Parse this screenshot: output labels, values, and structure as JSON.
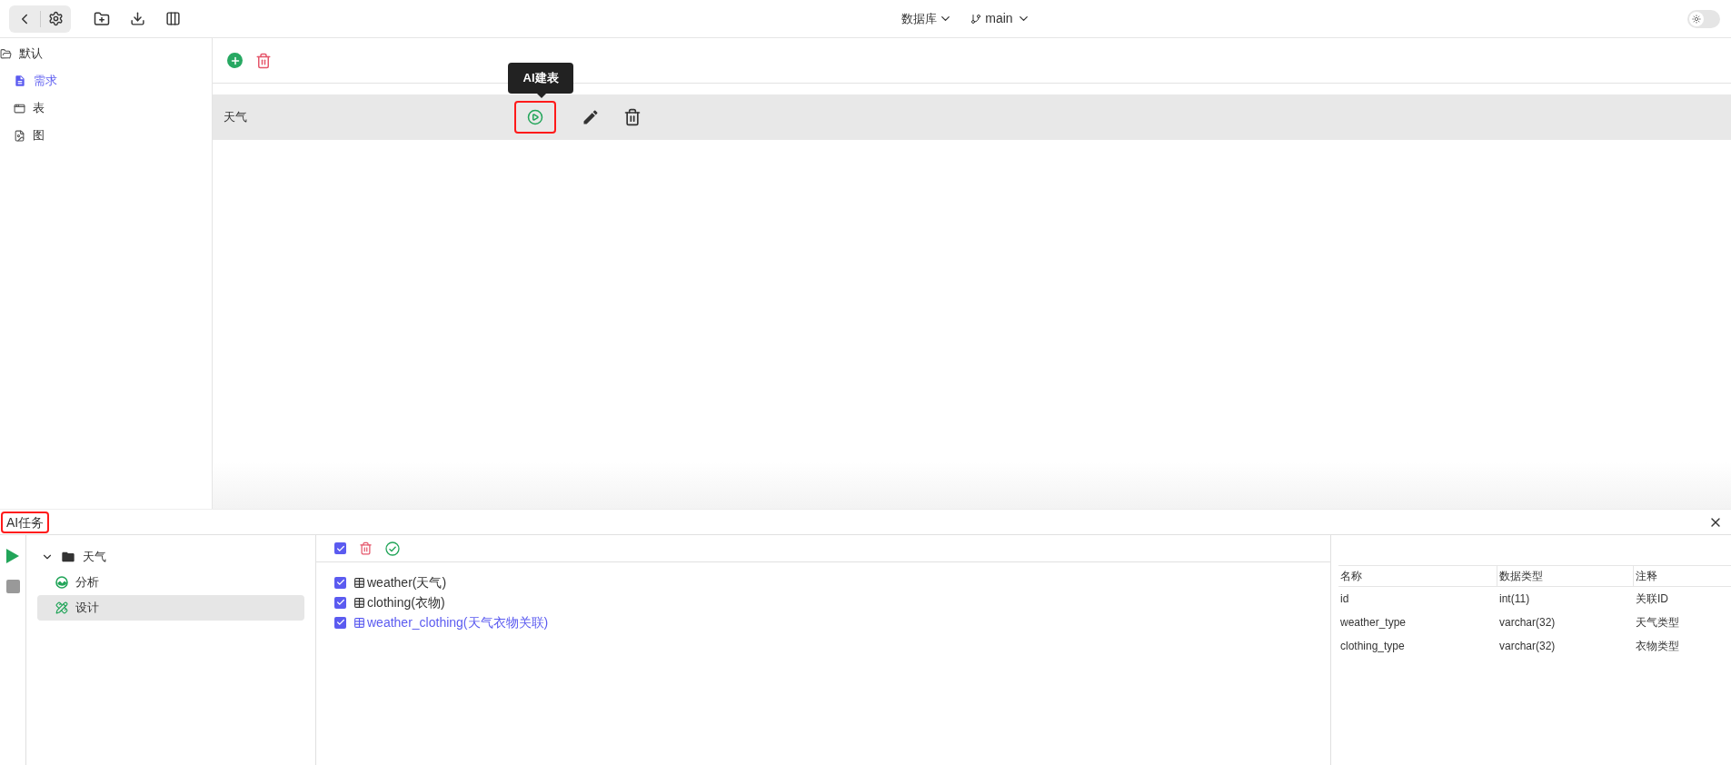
{
  "topbar": {
    "database_menu": "数据库",
    "branch_menu": "main",
    "theme_toggle": {
      "on": false
    }
  },
  "sidebar": {
    "items": [
      {
        "label": "默认",
        "kind": "folder",
        "selected": false,
        "children": [
          {
            "label": "需求",
            "kind": "doc",
            "selected": true
          },
          {
            "label": "表",
            "kind": "table",
            "selected": false
          },
          {
            "label": "图",
            "kind": "diagram",
            "selected": false
          }
        ]
      }
    ]
  },
  "requirements": {
    "rows": [
      {
        "label": "天气",
        "selected": true,
        "tooltip": "AI建表"
      }
    ]
  },
  "ai_task_panel": {
    "title": "AI任务",
    "tree": [
      {
        "label": "天气",
        "kind": "folder",
        "expanded": true,
        "selected": false,
        "children": [
          {
            "label": "分析",
            "kind": "analysis",
            "selected": false
          },
          {
            "label": "设计",
            "kind": "design",
            "selected": true
          }
        ]
      }
    ],
    "select_all": {
      "checked": true
    },
    "tables": [
      {
        "name": "weather(天气)",
        "checked": true,
        "selected": false
      },
      {
        "name": "clothing(衣物)",
        "checked": true,
        "selected": false
      },
      {
        "name": "weather_clothing(天气衣物关联)",
        "checked": true,
        "selected": true
      }
    ],
    "fields": {
      "columns": [
        "名称",
        "数据类型",
        "注释"
      ],
      "rows": [
        [
          "id",
          "int(11)",
          "关联ID"
        ],
        [
          "weather_type",
          "varchar(32)",
          "天气类型"
        ],
        [
          "clothing_type",
          "varchar(32)",
          "衣物类型"
        ]
      ]
    }
  }
}
